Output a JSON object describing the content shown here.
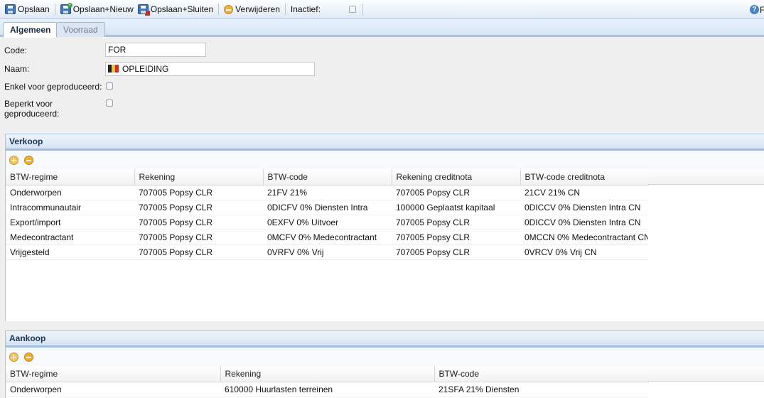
{
  "toolbar": {
    "save": "Opslaan",
    "save_new": "Opslaan+Nieuw",
    "save_close": "Opslaan+Sluiten",
    "delete": "Verwijderen",
    "inactive_label": "Inactief:",
    "help_label": "F"
  },
  "tabs": [
    "Algemeen",
    "Voorraad"
  ],
  "form": {
    "code_label": "Code:",
    "code_value": "FOR",
    "name_label": "Naam:",
    "name_value": "OPLEIDING",
    "only_produced_label": "Enkel voor geproduceerd:",
    "limited_label_1": "Beperkt voor",
    "limited_label_2": "geproduceerd:"
  },
  "sales": {
    "title": "Verkoop",
    "columns": [
      "BTW-regime",
      "Rekening",
      "BTW-code",
      "Rekening creditnota",
      "BTW-code creditnota"
    ],
    "rows": [
      [
        "Onderworpen",
        "707005 Popsy CLR",
        "21FV 21%",
        "707005 Popsy CLR",
        "21CV 21% CN"
      ],
      [
        "Intracommunautair",
        "707005 Popsy CLR",
        "0DICFV 0% Diensten Intra",
        "100000 Geplaatst kapitaal",
        "0DICCV 0% Diensten Intra CN"
      ],
      [
        "Export/import",
        "707005 Popsy CLR",
        "0EXFV 0% Uitvoer",
        "707005 Popsy CLR",
        "0DICCV 0% Diensten Intra CN"
      ],
      [
        "Medecontractant",
        "707005 Popsy CLR",
        "0MCFV 0% Medecontractant",
        "707005 Popsy CLR",
        "0MCCN 0% Medecontractant CN"
      ],
      [
        "Vrijgesteld",
        "707005 Popsy CLR",
        "0VRFV 0% Vrij",
        "707005 Popsy CLR",
        "0VRCV 0% Vrij CN"
      ]
    ]
  },
  "purchase": {
    "title": "Aankoop",
    "columns": [
      "BTW-regime",
      "Rekening",
      "BTW-code"
    ],
    "rows": [
      [
        "Onderworpen",
        "610000 Huurlasten terreinen",
        "21SFA 21% Diensten"
      ]
    ]
  },
  "icons": {
    "save": "save-disk-icon",
    "save_new": "save-new-icon",
    "save_close": "save-close-icon",
    "delete": "delete-icon",
    "help": "help-icon",
    "flag": "belgian-flag-icon",
    "add_row": "add-row-icon",
    "remove_row": "remove-row-icon"
  },
  "colors": {
    "toolbar_bg": "#dfeaf6",
    "panel_header": "#d5e4f3",
    "accent_border": "#9fbde0"
  }
}
